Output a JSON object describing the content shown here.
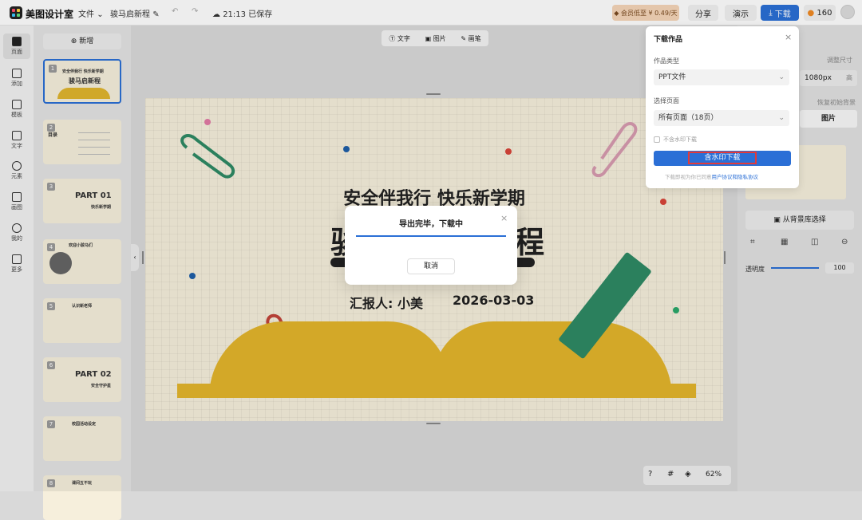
{
  "app": {
    "name": "美图设计室",
    "file_menu": "文件",
    "doc_title": "骏马启新程",
    "save_time": "21:13 已保存"
  },
  "header": {
    "vip_label": "会员低至 ¥ 0.49/天",
    "share": "分享",
    "present": "演示",
    "download": "下载",
    "credits": "160"
  },
  "sidebar": {
    "items": [
      {
        "label": "页面",
        "icon": "page-icon"
      },
      {
        "label": "添加",
        "icon": "add-icon"
      },
      {
        "label": "模板",
        "icon": "template-icon"
      },
      {
        "label": "文字",
        "icon": "text-icon"
      },
      {
        "label": "元素",
        "icon": "shape-icon"
      },
      {
        "label": "画图",
        "icon": "draw-icon"
      },
      {
        "label": "我的",
        "icon": "user-icon"
      },
      {
        "label": "更多",
        "icon": "more-icon"
      }
    ]
  },
  "pages": {
    "add_label": "新增",
    "thumbs": [
      {
        "num": "1",
        "title": "骏马启新程",
        "sub": "安全伴我行 快乐新学期"
      },
      {
        "num": "2",
        "title": "目录",
        "sub": ""
      },
      {
        "num": "3",
        "title": "PART 01",
        "sub": "快乐新学期"
      },
      {
        "num": "4",
        "title": "欢迎小骏马们",
        "sub": ""
      },
      {
        "num": "5",
        "title": "认识新老师",
        "sub": ""
      },
      {
        "num": "6",
        "title": "PART 02",
        "sub": "安全守护星"
      },
      {
        "num": "7",
        "title": "校园活动设定",
        "sub": ""
      },
      {
        "num": "8",
        "title": "课间五不玩",
        "sub": ""
      }
    ]
  },
  "canvas_toolbar": {
    "text": "文字",
    "image": "图片",
    "draw": "画笔"
  },
  "slide": {
    "heading": "安全伴我行 快乐新学期",
    "title_partial_left": "骏",
    "title_partial_right": "程",
    "presenter": "汇报人: 小美",
    "date": "2026-03-03"
  },
  "download_panel": {
    "title": "下载作品",
    "type_label": "作品类型",
    "type_value": "PPT文件",
    "page_label": "选择页面",
    "page_value": "所有页面（18页）",
    "no_watermark": "不含水印下载",
    "watermark_btn": "含水印下载",
    "notice_a": "下载即视为你已同意",
    "notice_b": "用户协议和隐私协议"
  },
  "right_panel": {
    "size_label": "调整尺寸",
    "size_value": "1080px",
    "h_label": "高",
    "bg_label": "恢复初始背景",
    "img_tab": "图片",
    "bg_lib": "从背景库选择",
    "opacity_label": "透明度",
    "opacity_value": "100"
  },
  "modal": {
    "title": "导出完毕，下载中",
    "cancel": "取消",
    "progress": 1.0
  },
  "bottom": {
    "zoom": "62%"
  },
  "colors": {
    "accent": "#2b6fd6",
    "vip": "#f6d6b8",
    "book": "#e4b52c",
    "marker": "#2f8a65"
  }
}
